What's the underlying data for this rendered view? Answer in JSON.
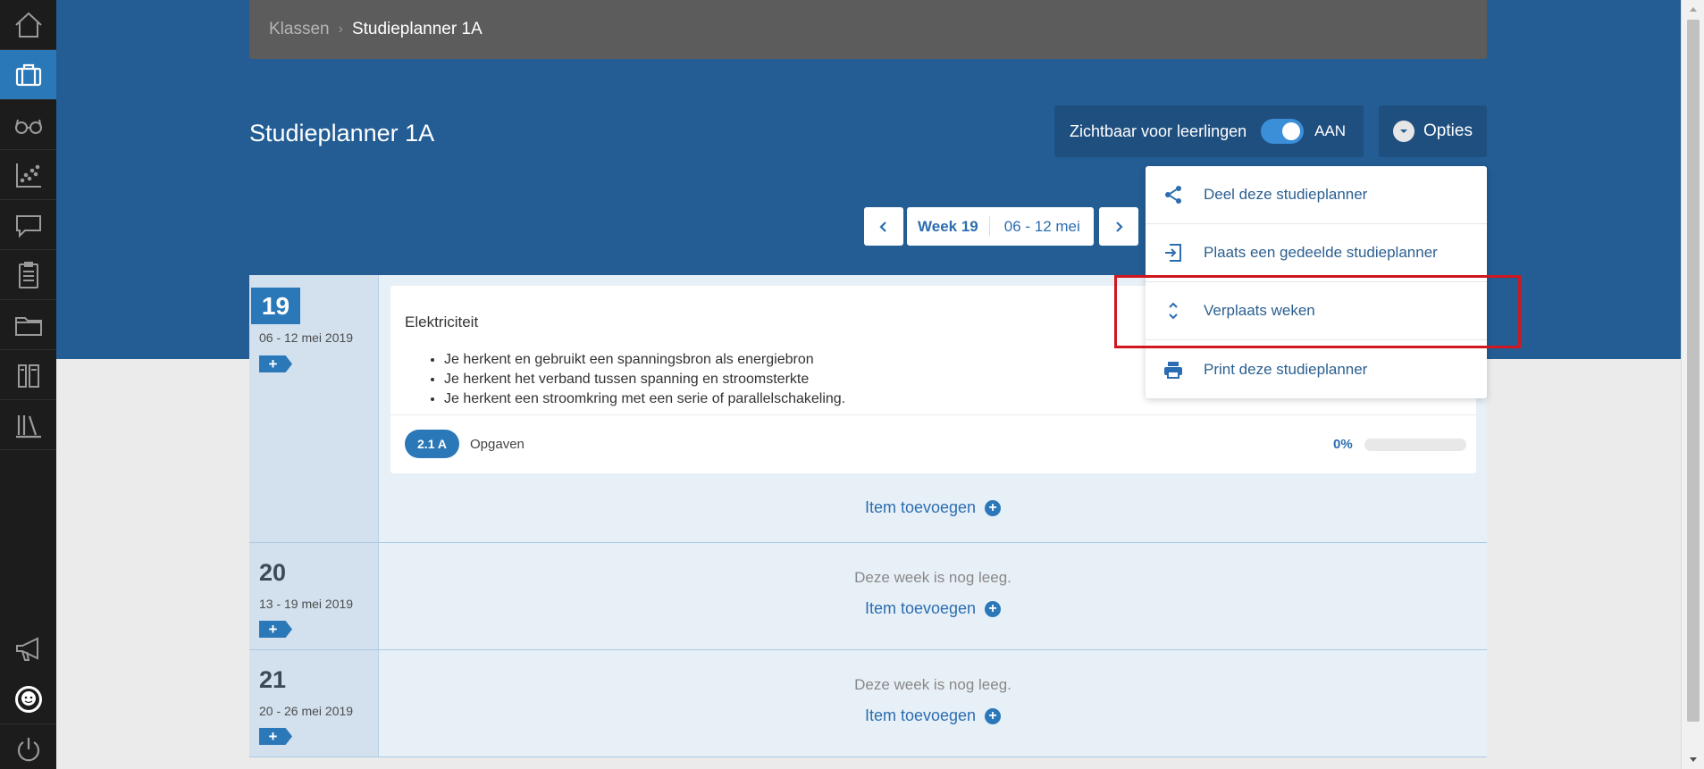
{
  "colors": {
    "sidebar_bg": "#1c1c1c",
    "header_band": "#235d94",
    "accent": "#2b78b8",
    "highlight": "#d0161e"
  },
  "sidebar": {
    "items": [
      {
        "icon": "home-icon"
      },
      {
        "icon": "briefcase-icon",
        "active": true
      },
      {
        "icon": "glasses-icon"
      },
      {
        "icon": "scatter-chart-icon"
      },
      {
        "icon": "chat-bubble-icon"
      },
      {
        "icon": "clipboard-icon"
      },
      {
        "icon": "folder-icon"
      },
      {
        "icon": "books-icon"
      },
      {
        "icon": "library-icon"
      },
      {
        "icon": "megaphone-icon"
      },
      {
        "icon": "avatar-icon"
      },
      {
        "icon": "power-icon"
      }
    ]
  },
  "breadcrumb": {
    "parent": "Klassen",
    "current": "Studieplanner 1A"
  },
  "page": {
    "title": "Studieplanner 1A"
  },
  "visibility": {
    "label": "Zichtbaar voor leerlingen",
    "state": "AAN",
    "on": true
  },
  "options": {
    "label": "Opties",
    "menu": [
      {
        "label": "Deel deze studieplanner",
        "icon": "share-icon"
      },
      {
        "label": "Plaats een gedeelde studieplanner",
        "icon": "import-icon"
      },
      {
        "label": "Verplaats weken",
        "icon": "reorder-icon"
      },
      {
        "label": "Print deze studieplanner",
        "icon": "printer-icon"
      }
    ]
  },
  "week_nav": {
    "week": "Week 19",
    "range": "06 - 12 mei"
  },
  "weeks": [
    {
      "number": "19",
      "dates": "06 - 12 mei 2019",
      "add": "+",
      "item": {
        "title": "Elektriciteit",
        "goals": [
          "Je herkent en gebruikt een spanningsbron als energiebron",
          "Je herkent het verband tussen spanning en stroomsterkte",
          "Je herkent een stroomkring met een serie of parallelschakeling."
        ],
        "tag": "2.1 A",
        "tag_label": "Opgaven",
        "progress_text": "0%",
        "progress": 0
      },
      "add_item": "Item toevoegen"
    },
    {
      "number": "20",
      "dates": "13 - 19 mei 2019",
      "add": "+",
      "empty": "Deze week is nog leeg.",
      "add_item": "Item toevoegen"
    },
    {
      "number": "21",
      "dates": "20 - 26 mei 2019",
      "add": "+",
      "empty": "Deze week is nog leeg.",
      "add_item": "Item toevoegen"
    }
  ]
}
